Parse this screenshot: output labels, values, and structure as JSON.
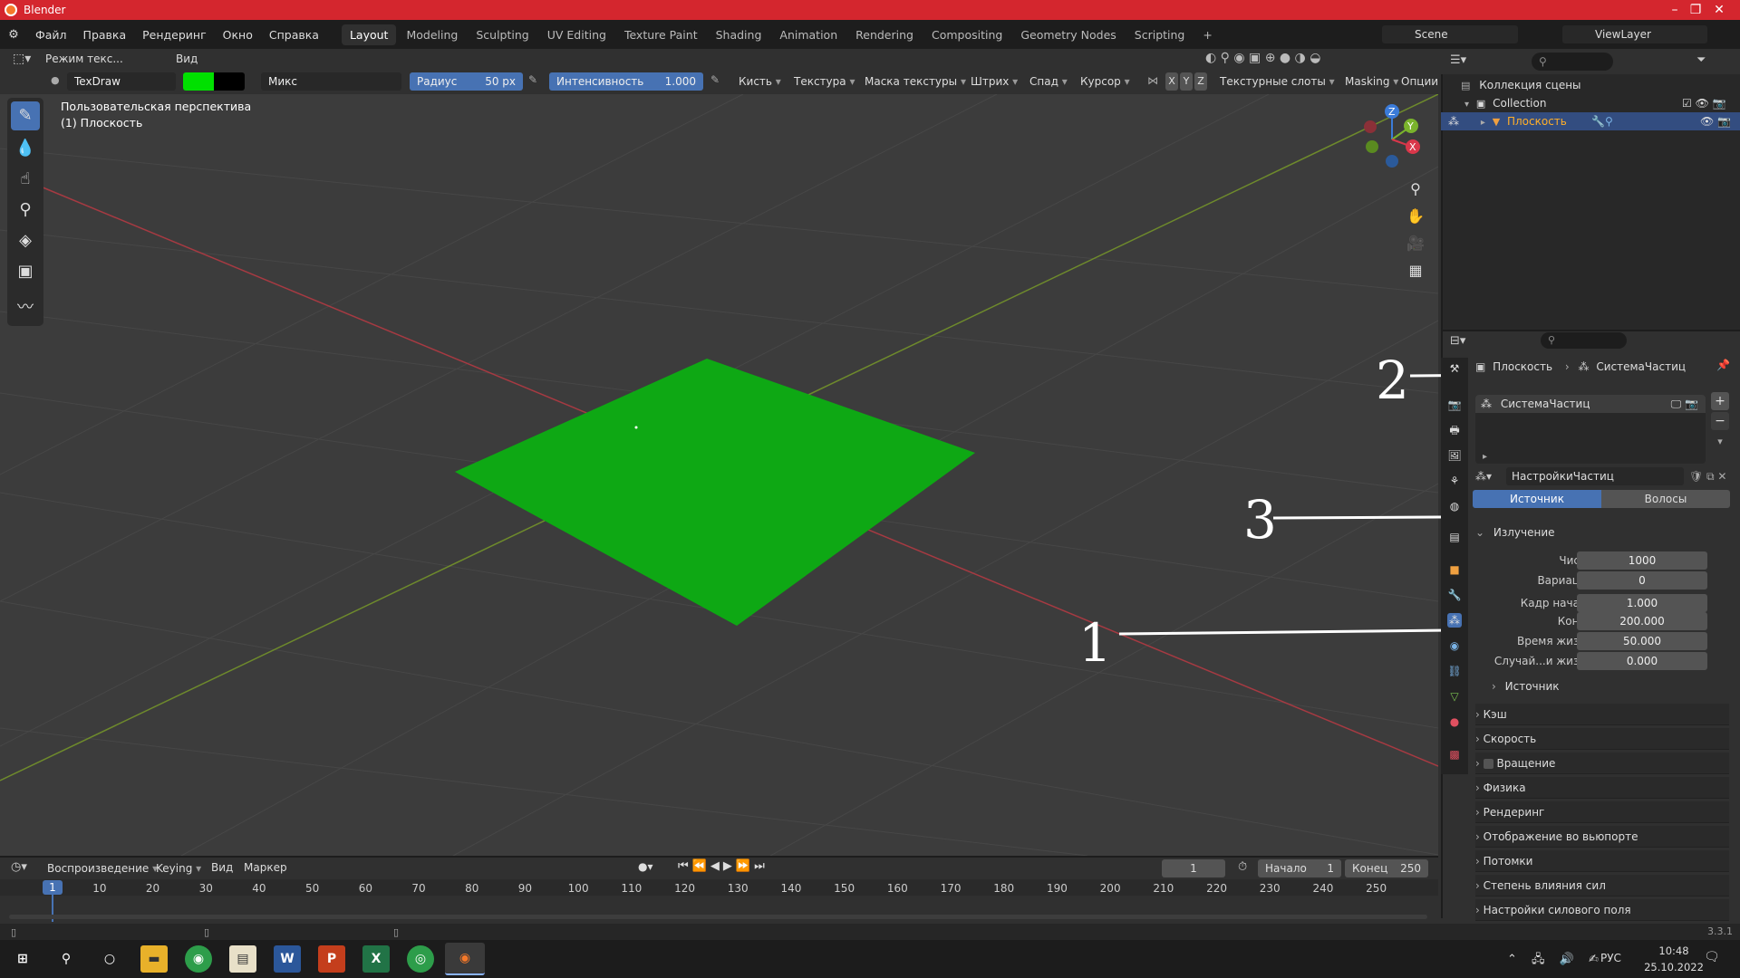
{
  "window": {
    "title": "Blender",
    "min": "–",
    "max": "❐",
    "close": "✕"
  },
  "menu": [
    "Файл",
    "Правка",
    "Рендеринг",
    "Окно",
    "Справка"
  ],
  "workspaces": [
    "Layout",
    "Modeling",
    "Sculpting",
    "UV Editing",
    "Texture Paint",
    "Shading",
    "Animation",
    "Rendering",
    "Compositing",
    "Geometry Nodes",
    "Scripting",
    "+"
  ],
  "scene": {
    "scene_name": "Scene",
    "view_layer": "ViewLayer"
  },
  "header": {
    "mode": "Режим текс...",
    "view": "Вид"
  },
  "toolsettings": {
    "brush": "TexDraw",
    "blend": "Микс",
    "radius_label": "Радиус",
    "radius_value": "50 px",
    "strength_label": "Интенсивность",
    "strength_value": "1.000",
    "brush_menu": "Кисть",
    "texture": "Текстура",
    "texture_mask": "Маска текстуры",
    "stroke": "Штрих",
    "falloff": "Спад",
    "cursor": "Курсор",
    "x": "X",
    "y": "Y",
    "z": "Z",
    "texture_slots": "Текстурные слоты",
    "masking": "Masking",
    "options": "Опции",
    "color_primary": "#00e000",
    "color_secondary": "#000000"
  },
  "viewport": {
    "overlay_line1": "Пользовательская перспектива",
    "overlay_line2": "(1) Плоскость",
    "plane_color": "#0ea814",
    "gizmo": {
      "x": "X",
      "y": "Y",
      "z": "Z"
    }
  },
  "outliner": {
    "scene_collection": "Коллекция сцены",
    "collection": "Collection",
    "object": "Плоскость"
  },
  "properties": {
    "breadcrumb_obj": "Плоскость",
    "breadcrumb_sys": "СистемаЧастиц",
    "list_item": "СистемаЧастиц",
    "settings_name": "НастройкиЧастиц",
    "tab_source": "Источник",
    "tab_hair": "Волосы",
    "emission": "Излучение",
    "rows": [
      {
        "label": "Число",
        "value": "1000"
      },
      {
        "label": "Вариация",
        "value": "0"
      },
      {
        "label": "Кадр начала",
        "value": "1.000"
      },
      {
        "label": "Конец",
        "value": "200.000"
      },
      {
        "label": "Время жизни",
        "value": "50.000"
      },
      {
        "label": "Случай...и жизни",
        "value": "0.000"
      }
    ],
    "source_sub": "Источник",
    "panels": [
      "Кэш",
      "Скорость",
      "Вращение",
      "Физика",
      "Рендеринг",
      "Отображение во вьюпорте",
      "Потомки",
      "Степень влияния сил",
      "Настройки силового поля"
    ]
  },
  "timeline": {
    "playback": "Воспроизведение",
    "keying": "Keying",
    "view": "Вид",
    "marker": "Маркер",
    "current_frame": "1",
    "start_label": "Начало",
    "start": "1",
    "end_label": "Конец",
    "end": "250",
    "ticks": [
      "10",
      "20",
      "30",
      "40",
      "50",
      "60",
      "70",
      "80",
      "90",
      "100",
      "110",
      "120",
      "130",
      "140",
      "150",
      "160",
      "170",
      "180",
      "190",
      "200",
      "210",
      "220",
      "230",
      "240",
      "250"
    ]
  },
  "status": {
    "version": "3.3.1"
  },
  "taskbar": {
    "lang": "РУС",
    "time": "10:48",
    "date": "25.10.2022"
  },
  "annotations": [
    "1",
    "2",
    "3"
  ]
}
